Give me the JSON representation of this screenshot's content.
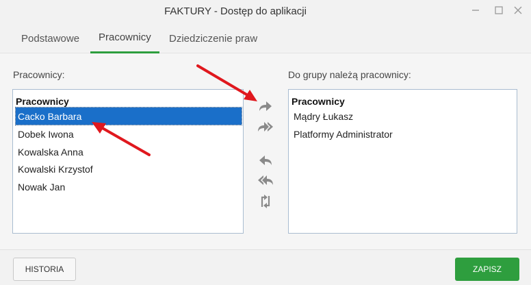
{
  "window": {
    "title": "FAKTURY - Dostęp do aplikacji",
    "minimize_icon": "minimize-icon",
    "maximize_icon": "maximize-icon",
    "close_icon": "close-icon"
  },
  "tabs": [
    {
      "label": "Podstawowe",
      "active": false
    },
    {
      "label": "Pracownicy",
      "active": true
    },
    {
      "label": "Dziedziczenie praw",
      "active": false
    }
  ],
  "left_panel": {
    "label": "Pracownicy:",
    "header": "Pracownicy",
    "items": [
      "Cacko Barbara",
      "Dobek Iwona",
      "Kowalska Anna",
      "Kowalski Krzystof",
      "Nowak Jan"
    ],
    "selected_index": 0
  },
  "right_panel": {
    "label": "Do grupy należą pracownicy:",
    "header": "Pracownicy",
    "items": [
      "Mądry Łukasz",
      "Platformy Administrator"
    ]
  },
  "transfer_buttons": [
    {
      "icon": "move-right-icon"
    },
    {
      "icon": "move-all-right-icon"
    },
    {
      "icon": "move-left-icon"
    },
    {
      "icon": "move-all-left-icon"
    },
    {
      "icon": "swap-icon"
    }
  ],
  "footer": {
    "history_label": "HISTORIA",
    "save_label": "ZAPISZ"
  },
  "colors": {
    "accent": "#2e9e3e",
    "selection": "#1a6fc9",
    "annotation_arrow": "#e0181e",
    "icon_gray": "#8a8a8a"
  }
}
